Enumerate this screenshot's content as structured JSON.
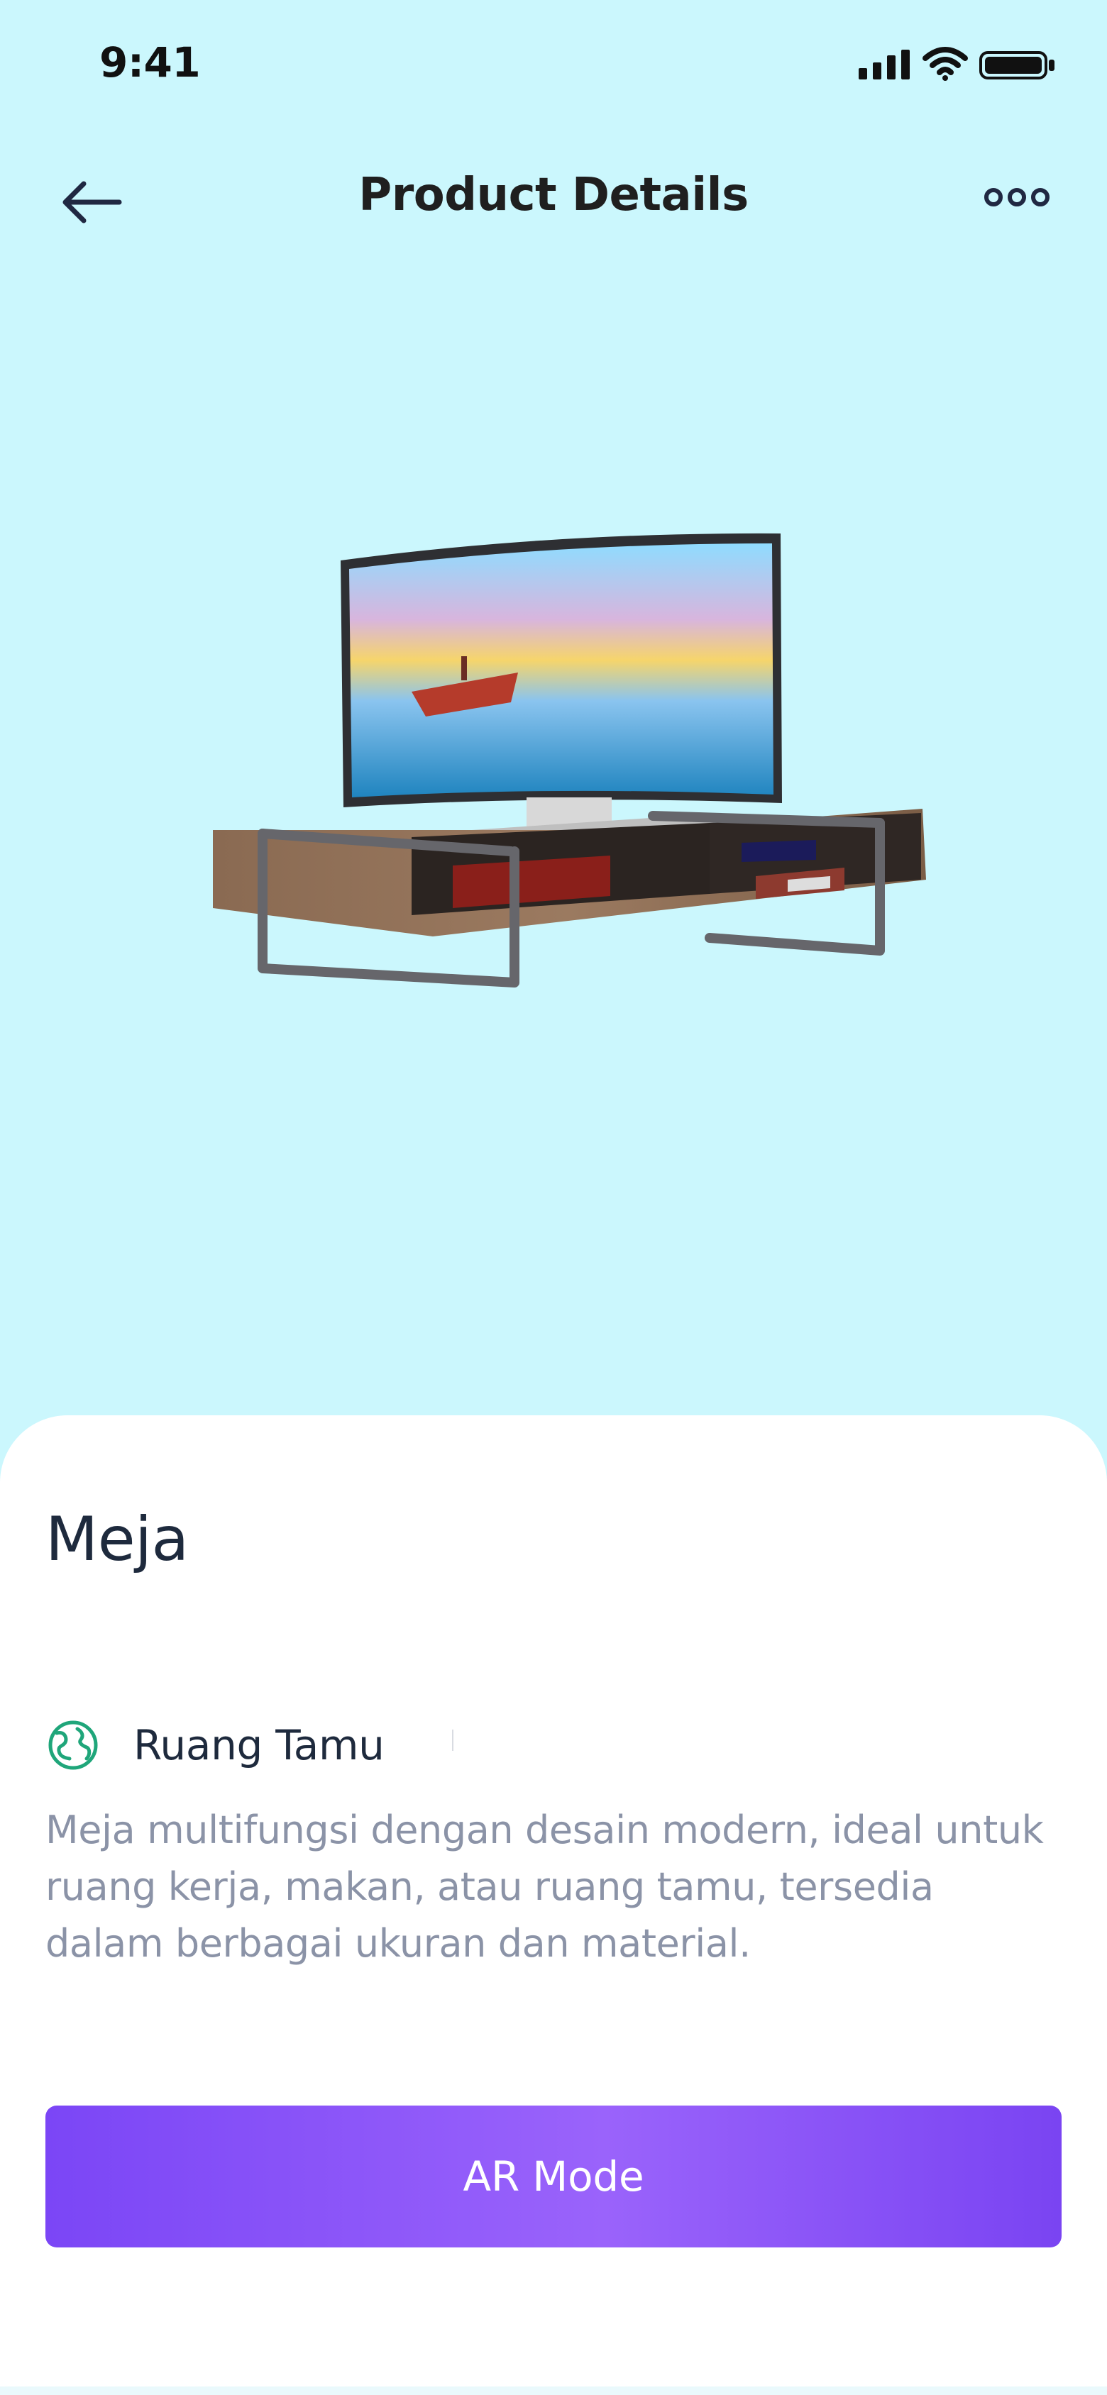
{
  "status_bar": {
    "time": "9:41",
    "icons": [
      "signal-icon",
      "wifi-icon",
      "battery-icon"
    ]
  },
  "header": {
    "back_icon": "arrow-left-icon",
    "title": "Product Details",
    "more_icon": "more-icon"
  },
  "product": {
    "image_description": "TV stand with TV",
    "name": "Meja",
    "room_icon": "globe-icon",
    "room": "Ruang Tamu",
    "description": "Meja multifungsi dengan desain modern, ideal untuk ruang kerja, makan, atau ruang tamu, tersedia dalam berbagai ukuran dan material.",
    "cta_label": "AR Mode"
  },
  "colors": {
    "background": "#CBF7FD",
    "sheet": "#FFFFFF",
    "accent_start": "#7B46F6",
    "accent_end": "#9A63FB",
    "title": "#1E2A3D",
    "muted_text": "#8B93A7",
    "room_icon": "#1FA67A"
  }
}
